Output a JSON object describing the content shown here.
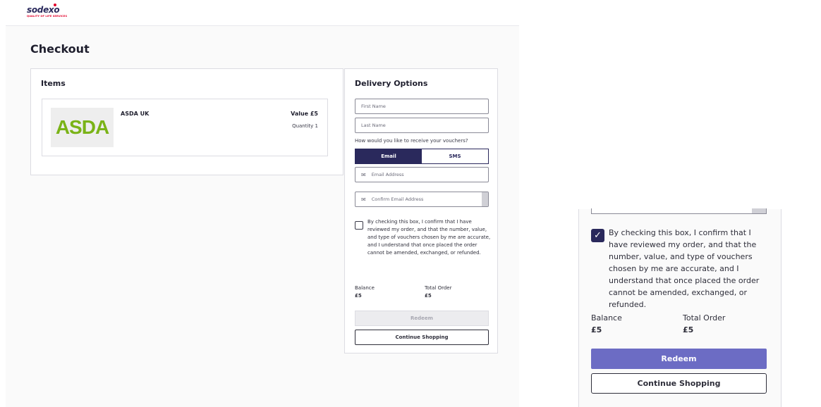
{
  "brand": {
    "name": "sodexo",
    "tagline": "QUALITY OF LIFE SERVICES"
  },
  "page": {
    "title": "Checkout"
  },
  "items": {
    "title": "Items",
    "list": [
      {
        "logo_text": "ASDA",
        "name": "ASDA UK",
        "value": "Value £5",
        "quantity": "Quantity 1"
      }
    ]
  },
  "delivery": {
    "title": "Delivery Options",
    "first_name_placeholder": "First Name",
    "last_name_placeholder": "Last Name",
    "receive_prompt": "How would you like to receive your vouchers?",
    "options": [
      "Email",
      "SMS"
    ],
    "selected_option": "Email",
    "email_placeholder": "Email Address",
    "confirm_email_placeholder": "Confirm Email Address",
    "terms_text": "By checking this box, I confirm that I have reviewed my order, and that the number, value, and type of vouchers chosen by me are accurate, and I understand that once placed the order cannot be amended, exchanged, or refunded.",
    "balance_label": "Balance",
    "balance_value": "£5",
    "total_label": "Total Order",
    "total_value": "£5",
    "redeem_label": "Redeem",
    "continue_label": "Continue Shopping"
  },
  "zoom": {
    "checkbox_checked": true,
    "redeem_enabled": true
  },
  "colors": {
    "navy": "#2a295c",
    "redeem_active": "#6c6cc4",
    "redeem_disabled": "#ececef",
    "asda_green": "#7ab317",
    "sodexo_red": "#e1002a"
  },
  "icons": {
    "email": "envelope-icon",
    "check": "checkmark-icon"
  }
}
